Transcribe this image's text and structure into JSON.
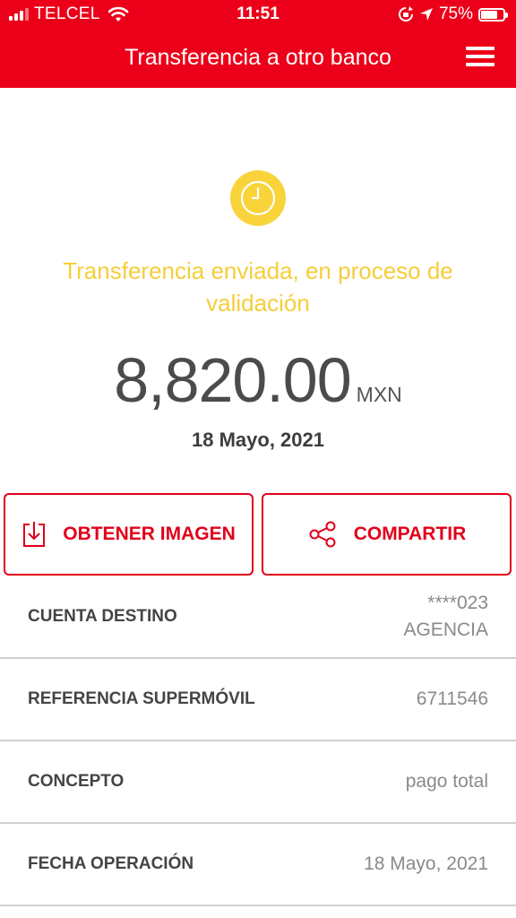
{
  "status_bar": {
    "carrier": "TELCEL",
    "time": "11:51",
    "battery_percent": "75%",
    "battery_level": 0.75
  },
  "header": {
    "title": "Transferencia a otro banco",
    "background_color": "#ec0019"
  },
  "status": {
    "icon": "clock-icon",
    "message": "Transferencia enviada, en proceso de validación",
    "color": "#f6cd3a"
  },
  "amount": {
    "value": "8,820.00",
    "currency": "MXN",
    "date": "18 Mayo, 2021"
  },
  "actions": [
    {
      "label": "OBTENER IMAGEN",
      "icon": "download-icon"
    },
    {
      "label": "COMPARTIR",
      "icon": "share-icon"
    }
  ],
  "details": [
    {
      "label": "CUENTA DESTINO",
      "value": "****023",
      "value2": "AGENCIA"
    },
    {
      "label": "REFERENCIA SUPERMÓVIL",
      "value": "6711546"
    },
    {
      "label": "CONCEPTO",
      "value": "pago total"
    },
    {
      "label": "FECHA OPERACIÓN",
      "value": "18 Mayo, 2021"
    }
  ]
}
